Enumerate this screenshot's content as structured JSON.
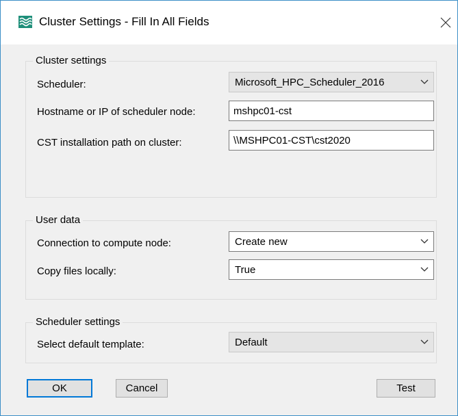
{
  "window": {
    "title": "Cluster Settings - Fill In All Fields",
    "app_icon": "cst-waves-icon",
    "close_icon": "close-icon",
    "accent_color": "#0078d7"
  },
  "cluster_settings": {
    "group_title": "Cluster settings",
    "scheduler_label": "Scheduler:",
    "scheduler_value": "Microsoft_HPC_Scheduler_2016",
    "hostname_label": "Hostname or IP of scheduler node:",
    "hostname_value": "mshpc01-cst",
    "install_path_label": "CST installation path on cluster:",
    "install_path_value": "\\\\MSHPC01-CST\\cst2020"
  },
  "user_data": {
    "group_title": "User data",
    "connection_label": "Connection to compute node:",
    "connection_value": "Create new",
    "copy_files_label": "Copy files locally:",
    "copy_files_value": "True"
  },
  "scheduler_settings": {
    "group_title": "Scheduler settings",
    "template_label": "Select default template:",
    "template_value": "Default"
  },
  "buttons": {
    "ok_label": "OK",
    "cancel_label": "Cancel",
    "test_label": "Test"
  }
}
